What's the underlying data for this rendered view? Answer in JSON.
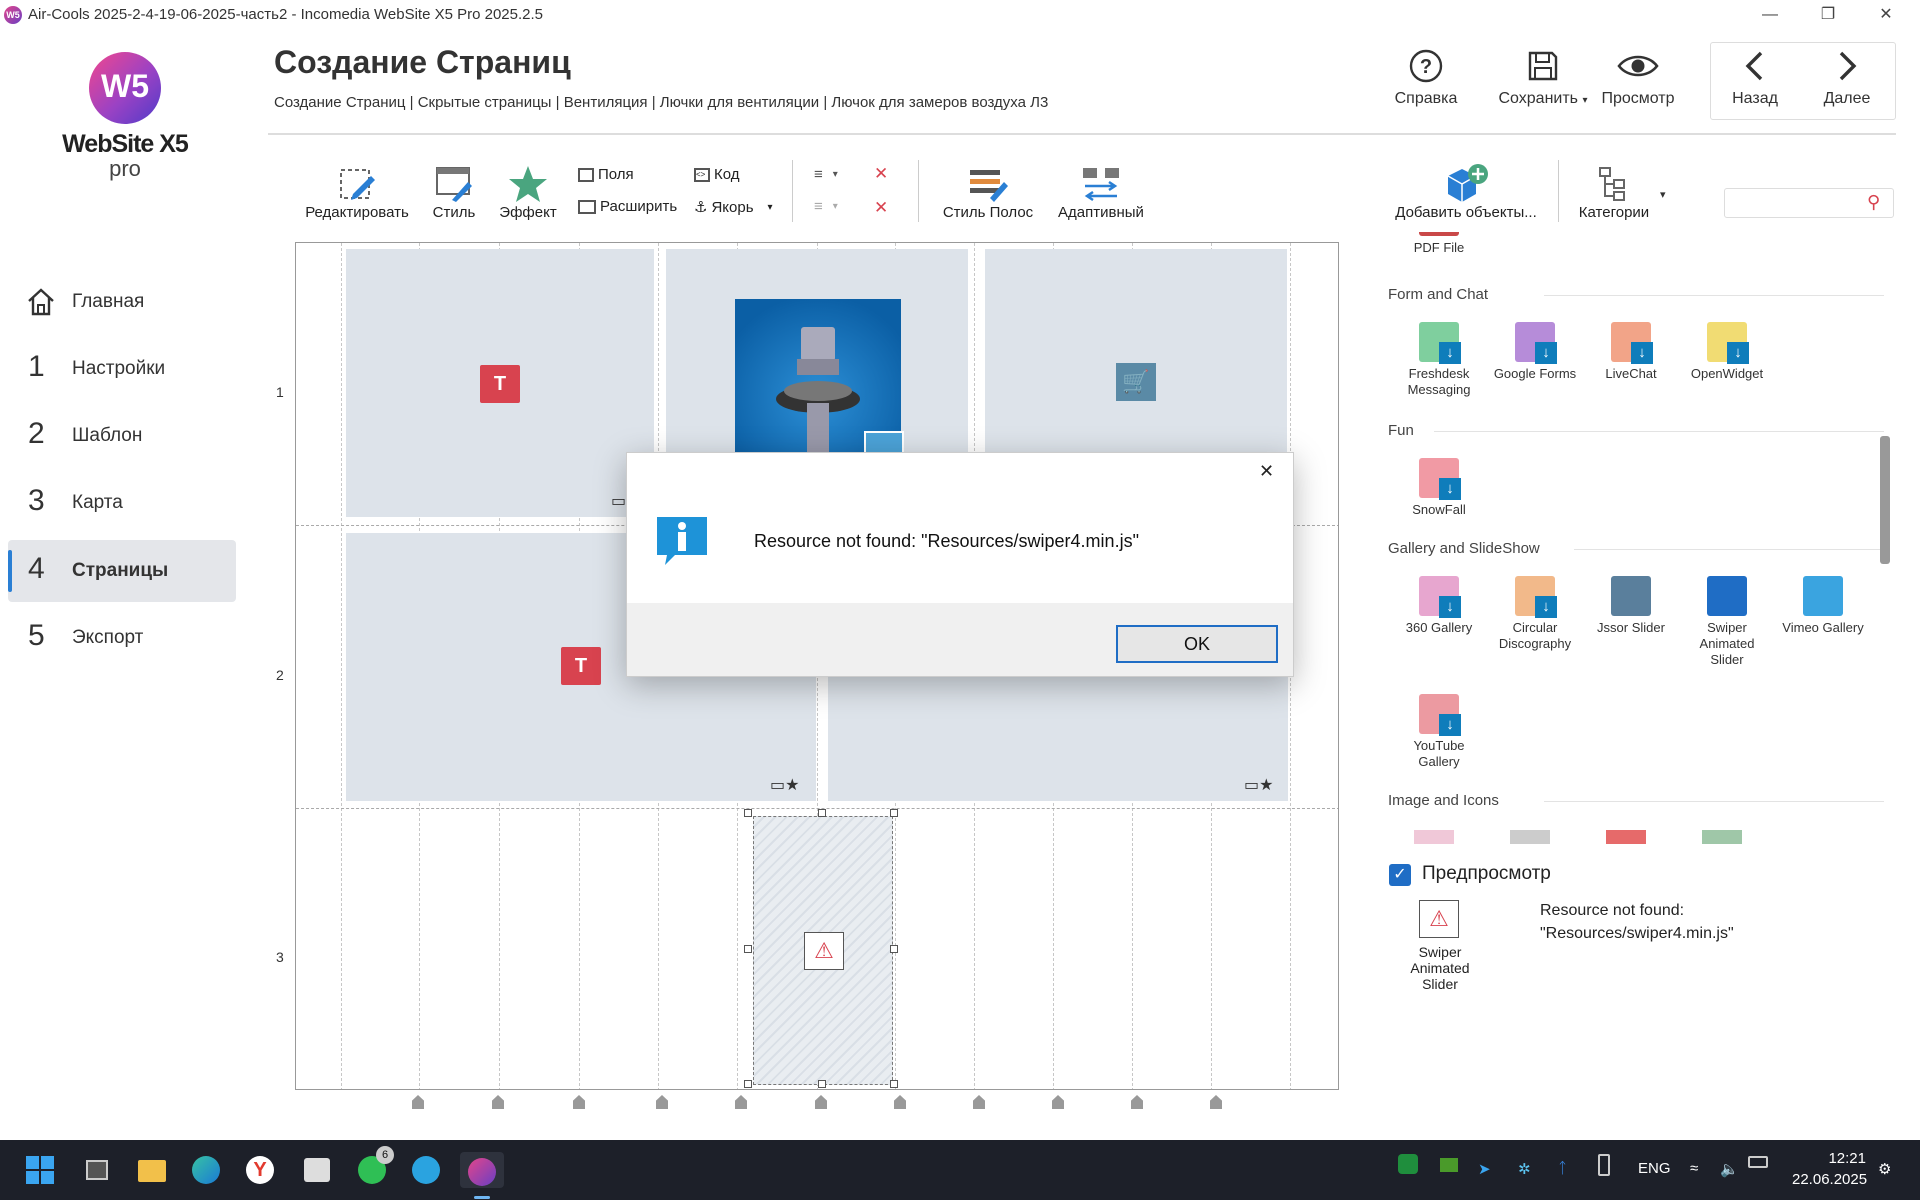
{
  "window": {
    "title": "Air-Cools 2025-2-4-19-06-2025-часть2 - Incomedia WebSite X5 Pro 2025.2.5",
    "icon": "w5-app-icon"
  },
  "logo": {
    "mark": "W5",
    "name": "WebSite X5",
    "edition": "pro"
  },
  "nav": [
    {
      "num": "",
      "label": "Главная",
      "icon": "home-icon"
    },
    {
      "num": "1",
      "label": "Настройки"
    },
    {
      "num": "2",
      "label": "Шаблон"
    },
    {
      "num": "3",
      "label": "Карта"
    },
    {
      "num": "4",
      "label": "Страницы",
      "active": true
    },
    {
      "num": "5",
      "label": "Экспорт"
    }
  ],
  "header": {
    "title": "Создание Страниц",
    "breadcrumb": "Создание Страниц | Скрытые страницы | Вентиляция | Лючки для вентиляции | Лючок для замеров воздуха Л3",
    "help": "Справка",
    "save": "Сохранить",
    "preview": "Просмотр",
    "back": "Назад",
    "next": "Далее"
  },
  "toolbar": {
    "edit": "Редактировать",
    "style": "Стиль",
    "effect": "Эффект",
    "margins": "Поля",
    "expand": "Расширить",
    "code": "Код",
    "anchor": "Якорь",
    "row_style": "Стиль Полос",
    "adaptive": "Адаптивный",
    "add_objects": "Добавить объекты...",
    "categories": "Категории"
  },
  "grid": {
    "rows": [
      "1",
      "2",
      "3"
    ]
  },
  "objects_panel": {
    "pdf": "PDF File",
    "categories": [
      {
        "name": "Form and Chat",
        "items": [
          "Freshdesk Messaging",
          "Google Forms",
          "LiveChat",
          "OpenWidget"
        ]
      },
      {
        "name": "Fun",
        "items": [
          "SnowFall"
        ]
      },
      {
        "name": "Gallery and SlideShow",
        "items": [
          "360 Gallery",
          "Circular Discography",
          "Jssor Slider",
          "Swiper Animated Slider",
          "Vimeo Gallery",
          "YouTube Gallery"
        ]
      },
      {
        "name": "Image and Icons",
        "items": []
      }
    ]
  },
  "preview": {
    "label": "Предпросмотр",
    "checked": true,
    "object": "Swiper Animated Slider",
    "message_line1": "Resource not found:",
    "message_line2": "\"Resources/swiper4.min.js\""
  },
  "dialog": {
    "message": "Resource not found: \"Resources/swiper4.min.js\"",
    "ok": "OK"
  },
  "taskbar": {
    "whatsapp_badge": "6",
    "lang": "ENG",
    "time": "12:21",
    "date": "22.06.2025"
  },
  "colors": {
    "accent": "#1f6dc5",
    "text_block": "#d8434f",
    "cell_bg": "#dde3ea",
    "taskbar": "#1d2029"
  }
}
